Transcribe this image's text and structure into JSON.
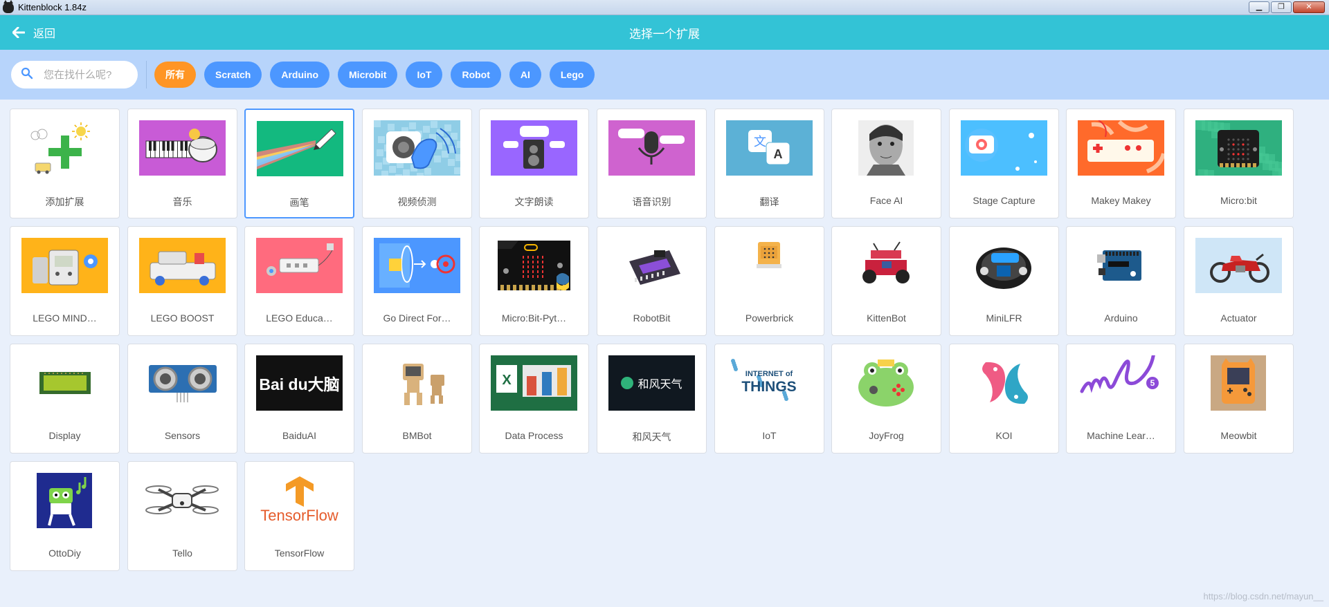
{
  "window": {
    "title": "Kittenblock 1.84z",
    "minimize": "▁",
    "restore": "❐",
    "close": "✕"
  },
  "header": {
    "back_label": "返回",
    "title": "选择一个扩展"
  },
  "search": {
    "placeholder": "您在找什么呢?"
  },
  "tags": [
    "所有",
    "Scratch",
    "Arduino",
    "Microbit",
    "IoT",
    "Robot",
    "AI",
    "Lego"
  ],
  "colors": {
    "header": "#33c3d6",
    "filterbar": "#b7d4fb",
    "tag": "#4c97ff",
    "tag_active": "#ff9524",
    "selected_border": "#4c97ff"
  },
  "extensions": [
    {
      "name": "添加扩展",
      "icon": "add-extension-icon",
      "text": ""
    },
    {
      "name": "音乐",
      "icon": "music-keyboard-drum-icon",
      "text": ""
    },
    {
      "name": "画笔",
      "icon": "pen-rainbow-icon",
      "text": ""
    },
    {
      "name": "视频侦测",
      "icon": "video-sensing-icon",
      "text": ""
    },
    {
      "name": "文字朗读",
      "icon": "text-to-speech-icon",
      "text": ""
    },
    {
      "name": "语音识别",
      "icon": "microphone-icon",
      "text": ""
    },
    {
      "name": "翻译",
      "icon": "translate-icon",
      "text": ""
    },
    {
      "name": "Face AI",
      "icon": "face-ai-icon",
      "text": ""
    },
    {
      "name": "Stage Capture",
      "icon": "camera-icon",
      "text": ""
    },
    {
      "name": "Makey Makey",
      "icon": "makey-makey-icon",
      "text": ""
    },
    {
      "name": "Micro:bit",
      "icon": "microbit-icon",
      "text": ""
    },
    {
      "name": "LEGO MIND…",
      "icon": "lego-mindstorms-icon",
      "text": ""
    },
    {
      "name": "LEGO BOOST",
      "icon": "lego-boost-icon",
      "text": ""
    },
    {
      "name": "LEGO Educa…",
      "icon": "lego-education-icon",
      "text": ""
    },
    {
      "name": "Go Direct For…",
      "icon": "force-sensor-icon",
      "text": ""
    },
    {
      "name": "Micro:Bit-Pyt…",
      "icon": "microbit-python-icon",
      "text": ""
    },
    {
      "name": "RobotBit",
      "icon": "robotbit-board-icon",
      "text": ""
    },
    {
      "name": "Powerbrick",
      "icon": "powerbrick-icon",
      "text": ""
    },
    {
      "name": "KittenBot",
      "icon": "kittenbot-robot-icon",
      "text": ""
    },
    {
      "name": "MiniLFR",
      "icon": "minilfr-robot-icon",
      "text": ""
    },
    {
      "name": "Arduino",
      "icon": "arduino-board-icon",
      "text": ""
    },
    {
      "name": "Actuator",
      "icon": "motorcycle-icon",
      "text": ""
    },
    {
      "name": "Display",
      "icon": "lcd-display-icon",
      "text": ""
    },
    {
      "name": "Sensors",
      "icon": "ultrasonic-sensor-icon",
      "text": ""
    },
    {
      "name": "BaiduAI",
      "icon": "baidu-logo-icon",
      "text": "Bai du大脑"
    },
    {
      "name": "BMBot",
      "icon": "bmbot-icon",
      "text": ""
    },
    {
      "name": "Data Process",
      "icon": "excel-icon",
      "text": ""
    },
    {
      "name": "和风天气",
      "icon": "weather-logo-icon",
      "text": "和风天气"
    },
    {
      "name": "IoT",
      "icon": "internet-of-things-icon",
      "text": "INTERNET of THINGS"
    },
    {
      "name": "JoyFrog",
      "icon": "frog-icon",
      "text": ""
    },
    {
      "name": "KOI",
      "icon": "koi-fish-icon",
      "text": ""
    },
    {
      "name": "Machine Lear…",
      "icon": "ml5-logo-icon",
      "text": "ml5"
    },
    {
      "name": "Meowbit",
      "icon": "meowbit-icon",
      "text": ""
    },
    {
      "name": "OttoDiy",
      "icon": "otto-robot-icon",
      "text": ""
    },
    {
      "name": "Tello",
      "icon": "drone-icon",
      "text": ""
    },
    {
      "name": "TensorFlow",
      "icon": "tensorflow-logo-icon",
      "text": "TensorFlow"
    }
  ],
  "watermark": "https://blog.csdn.net/mayun__"
}
